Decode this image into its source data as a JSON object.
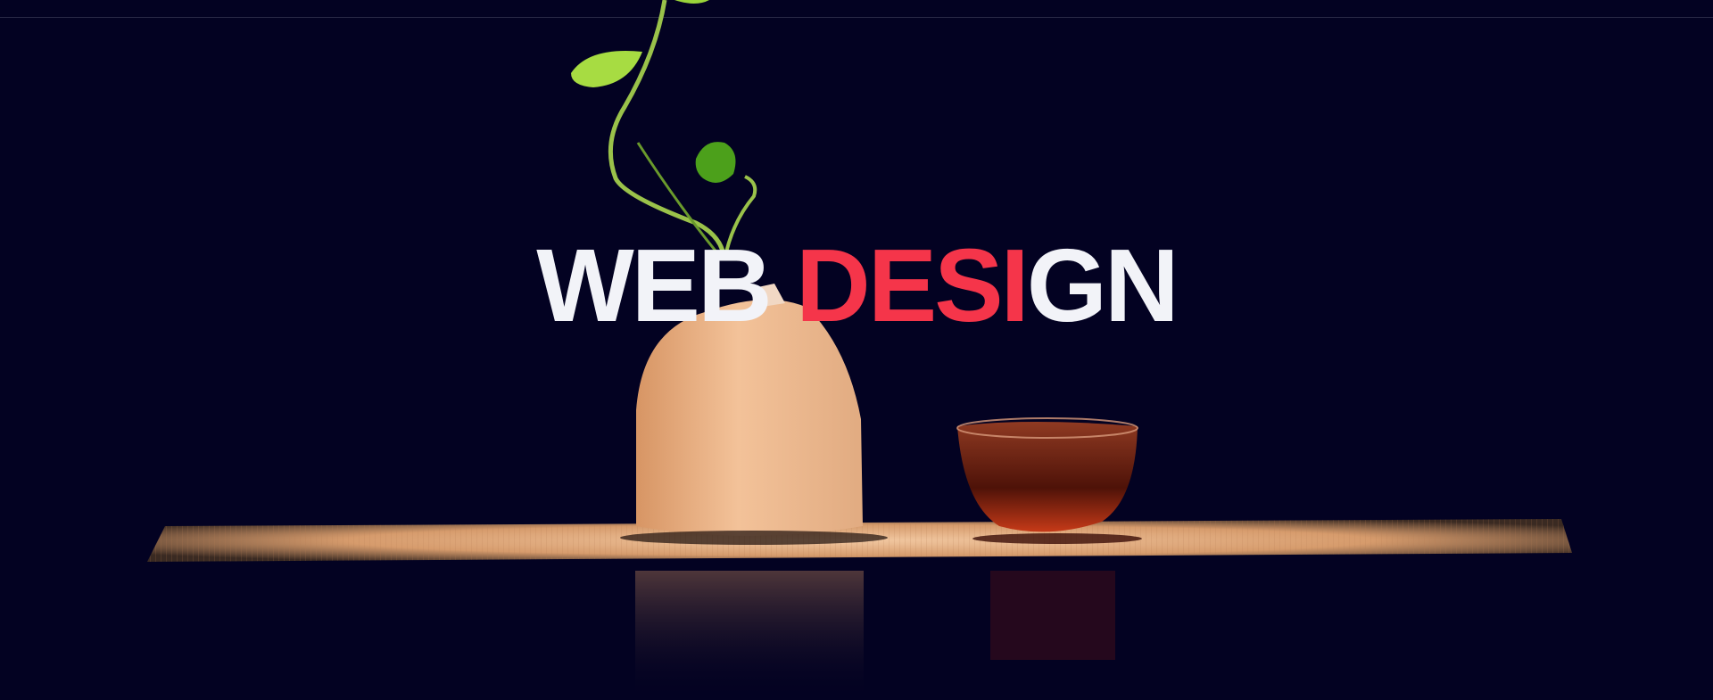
{
  "hero": {
    "title_part_1": "WEB ",
    "title_part_2": "DESI",
    "title_part_3": "GN"
  },
  "colors": {
    "background": "#030222",
    "title_white": "#f2f3f8",
    "title_accent": "#f5354a"
  }
}
